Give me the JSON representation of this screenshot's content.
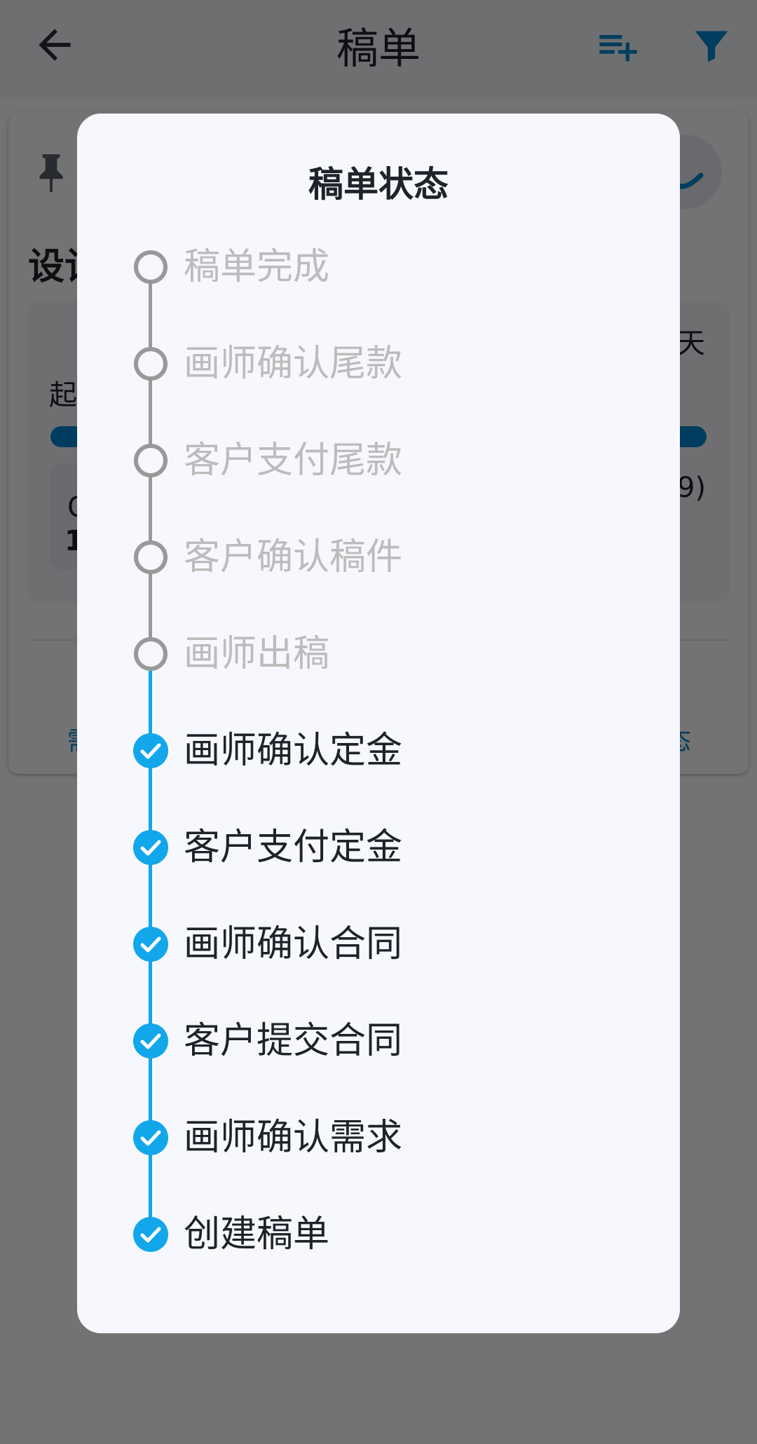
{
  "app_bar": {
    "title": "稿单",
    "back_icon": "arrow-back-icon",
    "add_icon": "playlist-add-icon",
    "filter_icon": "filter-icon"
  },
  "background_card": {
    "title_partial": "设计",
    "days_partial": "天",
    "start_partial": "起",
    "progress": 1.0,
    "sub_letter_partial": "G",
    "sub_number_partial": "1",
    "paren_partial": "9)",
    "left_action_partial": "需",
    "right_action_partial": "态",
    "pin_icon": "pin-icon"
  },
  "dialog": {
    "title": "稿单状态",
    "steps": [
      {
        "label": "稿单完成",
        "done": false
      },
      {
        "label": "画师确认尾款",
        "done": false
      },
      {
        "label": "客户支付尾款",
        "done": false
      },
      {
        "label": "客户确认稿件",
        "done": false
      },
      {
        "label": "画师出稿",
        "done": false
      },
      {
        "label": "画师确认定金",
        "done": true
      },
      {
        "label": "客户支付定金",
        "done": true
      },
      {
        "label": "画师确认合同",
        "done": true
      },
      {
        "label": "客户提交合同",
        "done": true
      },
      {
        "label": "画师确认需求",
        "done": true
      },
      {
        "label": "创建稿单",
        "done": true
      }
    ]
  },
  "colors": {
    "accent": "#12a7eb",
    "pending_line": "#999999",
    "pending_text": "#bcbcbc",
    "done_text": "#1f2329",
    "dialog_bg": "#f7f8fd"
  }
}
